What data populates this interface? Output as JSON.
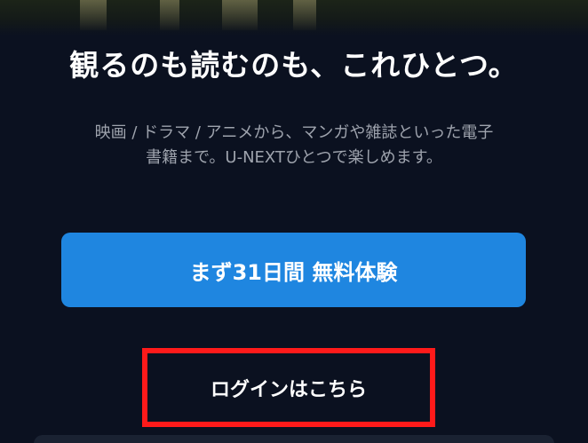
{
  "hero": {
    "headline": "観るのも読むのも、これひとつ。",
    "description_line1": "映画 / ドラマ / アニメから、マンガや雑誌といった電子",
    "description_line2": "書籍まで。U-NEXTひとつで楽しめます。"
  },
  "actions": {
    "trial_label": "まず31日間 無料体験",
    "login_label": "ログインはこちら"
  },
  "colors": {
    "primary_button": "#1f86e0",
    "highlight_border": "#ff1a1a",
    "background": "#0b1120"
  }
}
